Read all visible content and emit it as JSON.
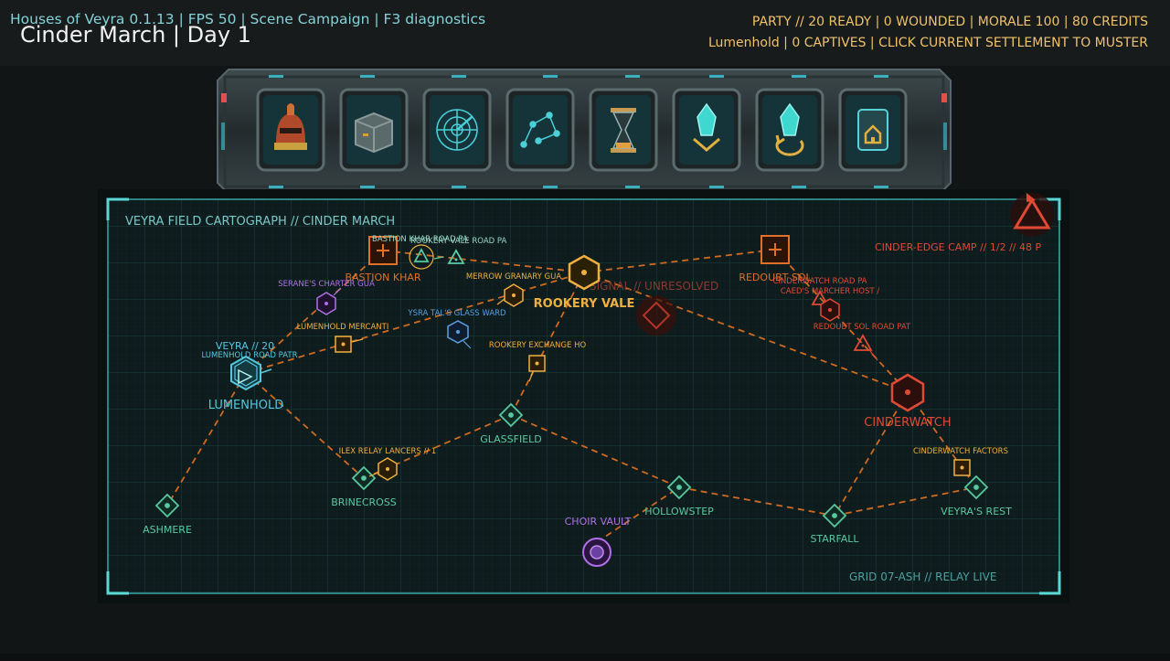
{
  "header": {
    "debug_line": "Houses of Veyra 0.1.13 | FPS 50 | Scene Campaign | F3 diagnostics",
    "title": "Cinder March  |  Day 1",
    "status_line": "PARTY // 20 READY | 0 WOUNDED | MORALE 100 | 80 CREDITS",
    "settlement_line": "Lumenhold | 0 CAPTIVES | CLICK CURRENT SETTLEMENT TO MUSTER"
  },
  "toolbar": {
    "buttons": [
      {
        "icon": "helmet-icon"
      },
      {
        "icon": "supply-crate-icon"
      },
      {
        "icon": "radar-icon"
      },
      {
        "icon": "constellation-icon"
      },
      {
        "icon": "hourglass-icon"
      },
      {
        "icon": "crystal-deposit-icon"
      },
      {
        "icon": "crystal-recall-icon"
      },
      {
        "icon": "home-gate-icon"
      }
    ]
  },
  "map": {
    "title": "VEYRA FIELD CARTOGRAPH // CINDER MARCH",
    "grid_label": "GRID 07-ASH // RELAY LIVE",
    "enemy_camp": "CINDER-EDGE CAMP // 1/2 // 48 P",
    "player_label": "VEYRA // 20",
    "signal": "SIGNAL // UNRESOLVED",
    "settlements": {
      "lumenhold": "LUMENHOLD",
      "rookery_vale": "ROOKERY VALE",
      "cinderwatch": "CINDERWATCH",
      "bastion_khar": "BASTION KHAR",
      "redoubt_sol": "REDOUBT SOL",
      "glassfield": "GLASSFIELD",
      "brinecross": "BRINECROSS",
      "ashmere": "ASHMERE",
      "hollowstep": "HOLLOWSTEP",
      "starfall": "STARFALL",
      "veyras_rest": "VEYRA'S REST",
      "choir_vault": "CHOIR VAULT"
    },
    "parties": {
      "lumenhold_road_patr": "LUMENHOLD ROAD PATR",
      "lumenhold_mercanti": "LUMENHOLD MERCANTI",
      "seranes_charter": "SERANE'S CHARTER GUA",
      "bastion_khar_road": "BASTION KHAR ROAD PA",
      "rookery_vale_road": "ROOKERY VALE ROAD PA",
      "merrow_granary": "MERROW GRANARY GUA",
      "ysra_tal": "YSRA TAL'S GLASS WARD",
      "rookery_exchange": "ROOKERY EXCHANGE HO",
      "ilex_relay": "ILEX RELAY LANCERS // 1",
      "cinderwatch_road": "CINDERWATCH ROAD PA",
      "caeds_marcher": "CAED'S MARCHER HOST /",
      "redoubt_sol_road": "REDOUBT SOL ROAD PAT",
      "cinderwatch_factors": "CINDERWATCH FACTORS"
    }
  },
  "colors": {
    "route": "#d06a20",
    "neutral": "#58c9a0",
    "friendly": "#54c8e0",
    "trade": "#f0b040",
    "hostile": "#e04a35",
    "mystic": "#b070e8",
    "ally_blue": "#5aa0e0"
  }
}
